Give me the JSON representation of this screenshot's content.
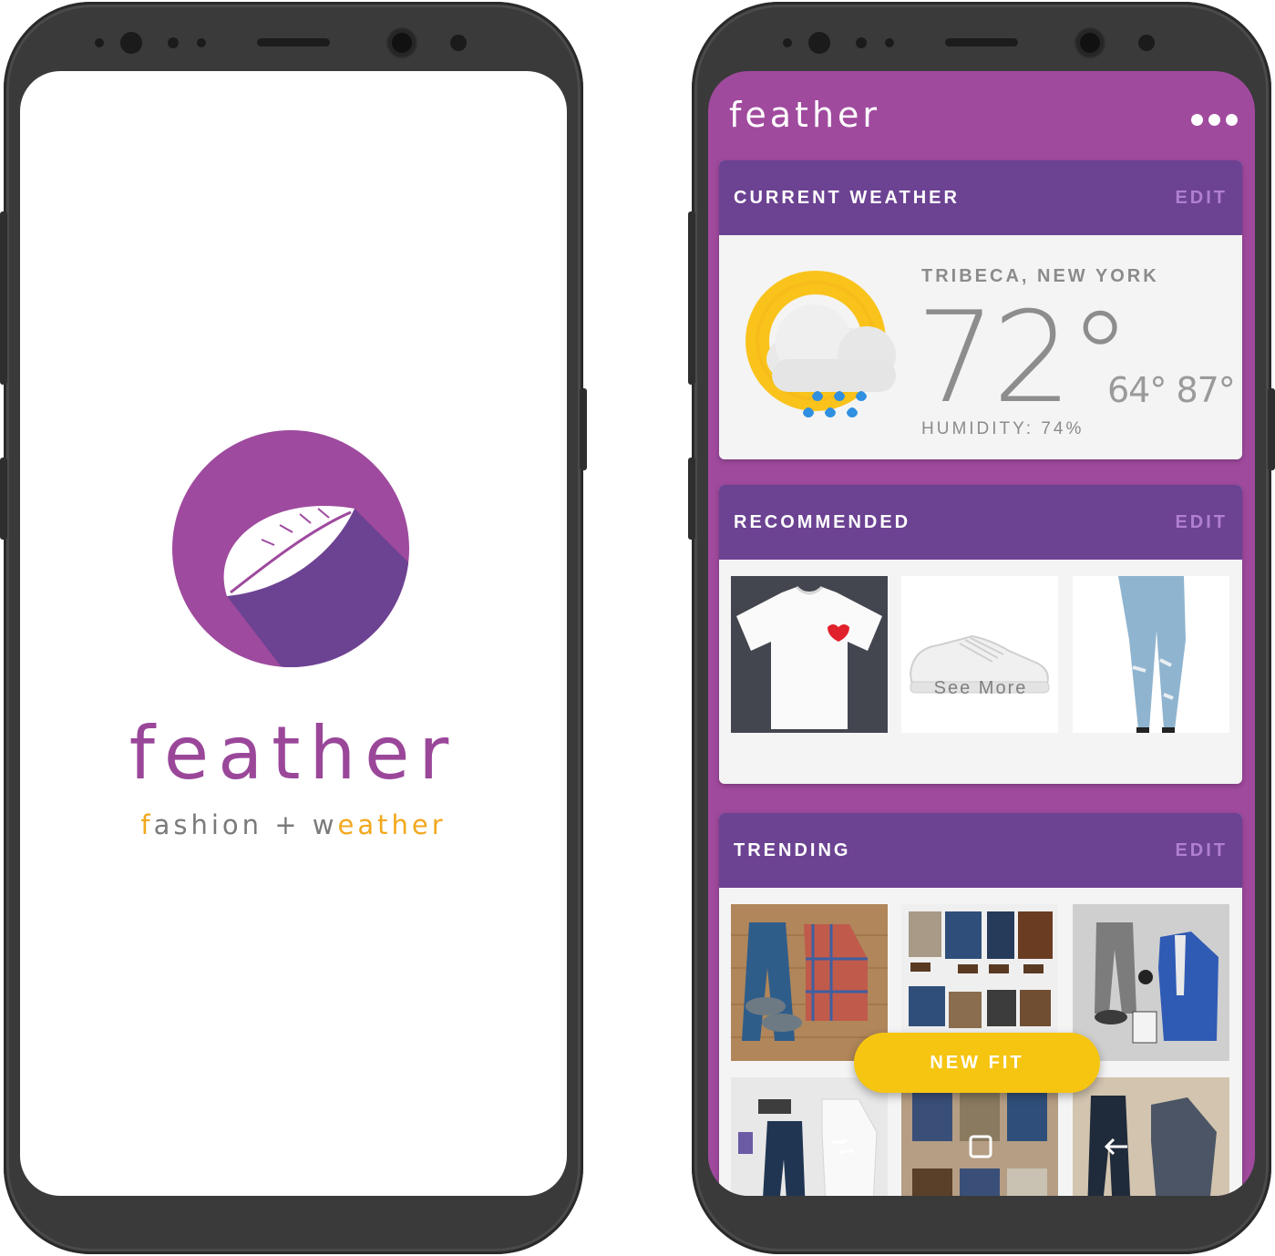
{
  "splash": {
    "title": "feather",
    "tagline_pre": "f",
    "tagline_mid": "ashion + w",
    "tagline_post": "eather",
    "logo_icon": "feather-icon",
    "colors": {
      "brand_purple": "#9e4a9e",
      "accent_orange": "#f2a81d"
    }
  },
  "app": {
    "title": "feather",
    "menu_icon": "more-dots-icon",
    "weather_card": {
      "header": "CURRENT WEATHER",
      "edit": "EDIT",
      "location": "TRIBECA, NEW YORK",
      "temperature": "72°",
      "low": "64°",
      "high": "87°",
      "humidity": "HUMIDITY: 74%",
      "icon": "sun-cloud-rain-icon"
    },
    "recommended_card": {
      "header": "RECOMMENDED",
      "edit": "EDIT",
      "items": [
        "t-shirt-image",
        "sneaker-image",
        "jeans-image"
      ],
      "see_more": "See More"
    },
    "trending_card": {
      "header": "TRENDING",
      "edit": "EDIT",
      "items": [
        "outfit-1",
        "outfit-2",
        "outfit-3",
        "outfit-4",
        "outfit-5",
        "outfit-6"
      ]
    },
    "fab_label": "NEW FIT",
    "nav": [
      "recents-icon",
      "home-icon",
      "back-icon"
    ],
    "colors": {
      "app_bg": "#a04a9e",
      "header_purple": "#6c4292",
      "fab_yellow": "#f6c512"
    }
  }
}
